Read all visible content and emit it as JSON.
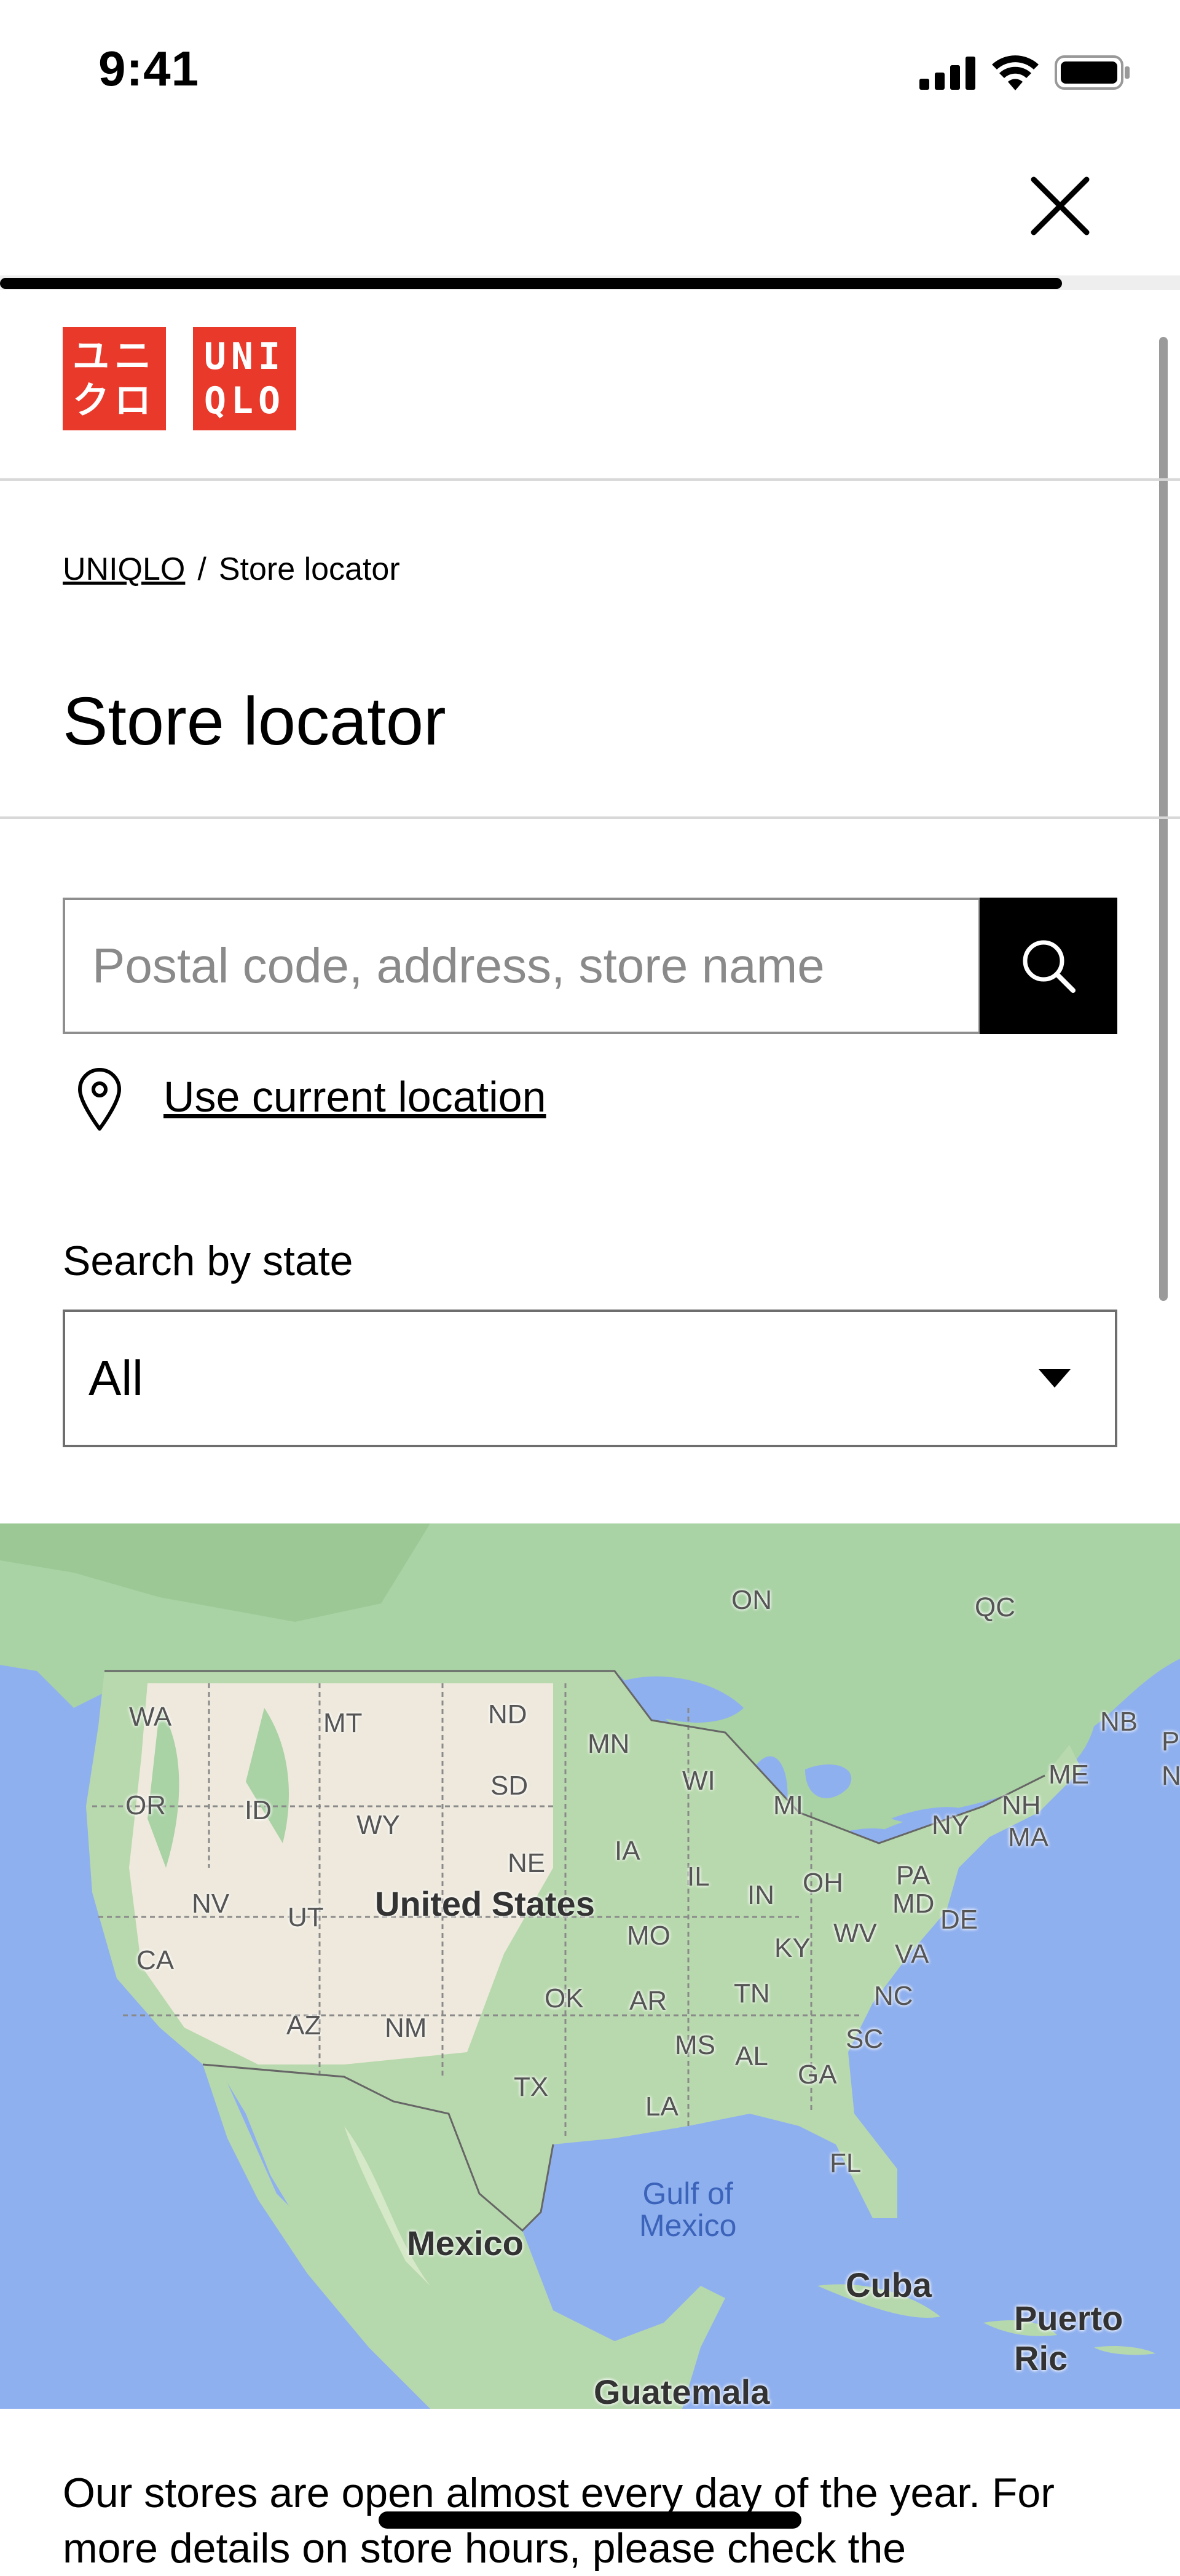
{
  "status_bar": {
    "time": "9:41"
  },
  "page": {
    "close_label": "Close",
    "progress_percent": 90
  },
  "logo": {
    "line1": "ユニ",
    "line2": "クロ",
    "latin1": "UNI",
    "latin2": "QLO"
  },
  "breadcrumb": {
    "home": "UNIQLO",
    "separator": "/",
    "current": "Store locator"
  },
  "title": "Store locator",
  "search": {
    "placeholder": "Postal code, address, store name",
    "value": ""
  },
  "location": {
    "label": "Use current location"
  },
  "state_filter": {
    "label": "Search by state",
    "selected": "All"
  },
  "map": {
    "labels": {
      "ON": "ON",
      "QC": "QC",
      "NB": "NB",
      "NS": "NS",
      "WA": "WA",
      "MT": "MT",
      "ND": "ND",
      "MN": "MN",
      "OR": "OR",
      "ID": "ID",
      "SD": "SD",
      "WI": "WI",
      "MI": "MI",
      "NY": "NY",
      "ME": "ME",
      "NH": "NH",
      "MA": "MA",
      "WY": "WY",
      "NE": "NE",
      "IA": "IA",
      "IL": "IL",
      "IN": "IN",
      "OH": "OH",
      "PA": "PA",
      "MD": "MD",
      "DE": "DE",
      "NV": "NV",
      "UT": "UT",
      "MO": "MO",
      "KY": "KY",
      "WV": "WV",
      "VA": "VA",
      "CA": "CA",
      "OK": "OK",
      "AR": "AR",
      "TN": "TN",
      "NC": "NC",
      "AZ": "AZ",
      "NM": "NM",
      "MS": "MS",
      "AL": "AL",
      "SC": "SC",
      "GA": "GA",
      "TX": "TX",
      "LA": "LA",
      "FL": "FL",
      "P": "P"
    },
    "countries": {
      "us": "United States",
      "mexico": "Mexico",
      "cuba": "Cuba",
      "puerto_rico": "Puerto Ric",
      "guatemala": "Guatemala"
    },
    "sea": {
      "line1": "Gulf of",
      "line2": "Mexico"
    }
  },
  "info_text": "Our stores are open almost every day of the year. For more details on store hours, please check the"
}
